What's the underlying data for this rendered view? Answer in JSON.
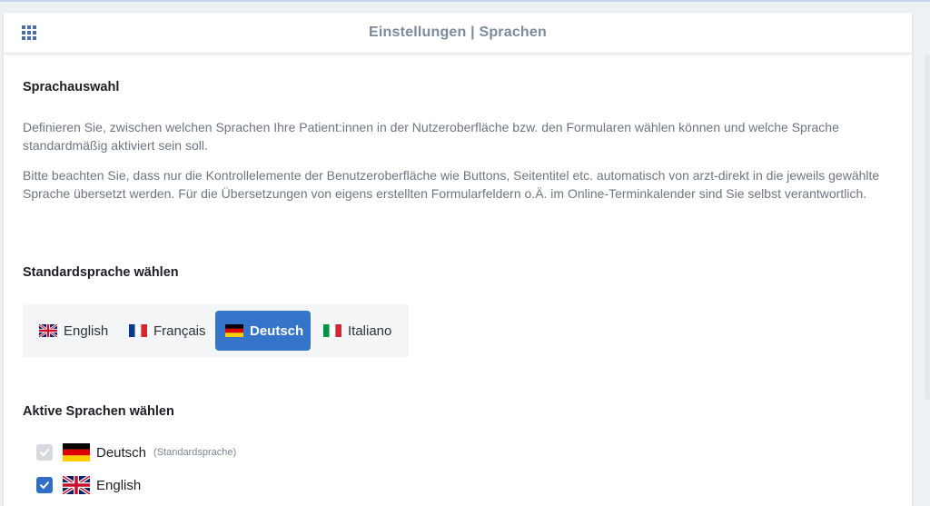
{
  "header": {
    "title": "Einstellungen | Sprachen"
  },
  "sprachauswahl": {
    "heading": "Sprachauswahl",
    "paragraph1": "Definieren Sie, zwischen welchen Sprachen Ihre Patient:innen in der Nutzeroberfläche bzw. den Formularen wählen können und welche Sprache standardmäßig aktiviert sein soll.",
    "paragraph2": "Bitte beachten Sie, dass nur die Kontrollelemente der Benutzeroberfläche wie Buttons, Seitentitel etc. automatisch von arzt-direkt in die jeweils gewählte Sprache übersetzt werden. Für die Übersetzungen von eigens erstellten Formularfeldern o.Ä. im Online-Terminkalender sind Sie selbst verantwortlich."
  },
  "standard": {
    "heading": "Standardsprache wählen",
    "options": [
      {
        "label": "English",
        "flag": "uk-flag-icon",
        "selected": false
      },
      {
        "label": "Français",
        "flag": "france-flag-icon",
        "selected": false
      },
      {
        "label": "Deutsch",
        "flag": "germany-flag-icon",
        "selected": true
      },
      {
        "label": "Italiano",
        "flag": "italy-flag-icon",
        "selected": false
      }
    ]
  },
  "aktiv": {
    "heading": "Aktive Sprachen wählen",
    "items": [
      {
        "label": "Deutsch",
        "note": "(Standardsprache)",
        "checked": true,
        "disabled": true,
        "flag": "germany-flag-icon"
      },
      {
        "label": "English",
        "note": "",
        "checked": true,
        "disabled": false,
        "flag": "uk-flag-icon"
      }
    ]
  },
  "colors": {
    "accent": "#3575c9",
    "checkbox_checked": "#2f6fc4",
    "checkbox_disabled": "#d6d9dd",
    "header_title": "#7b8a99",
    "body_text": "#6c7680"
  }
}
